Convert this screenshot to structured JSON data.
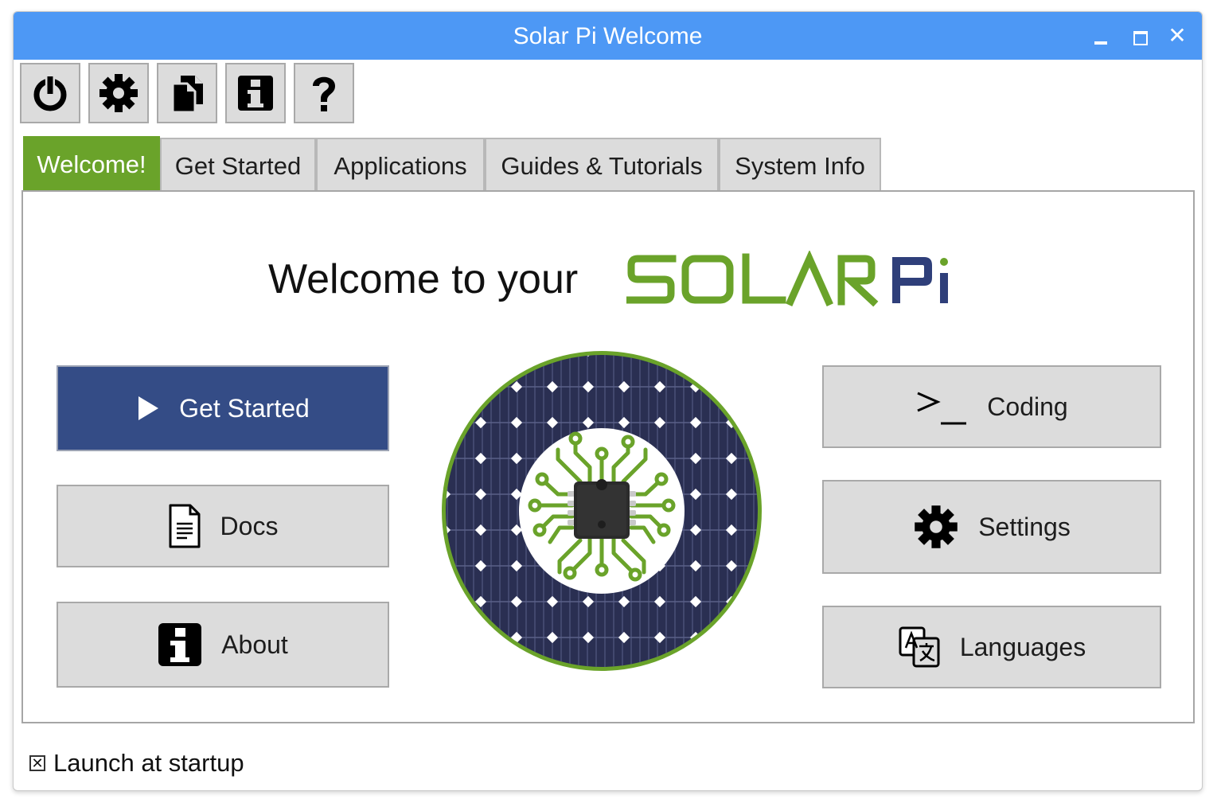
{
  "window": {
    "title": "Solar Pi Welcome",
    "controls": {
      "minimize": "–",
      "maximize": "□",
      "close": "✕"
    }
  },
  "toolbar": {
    "buttons": [
      {
        "name": "power-icon"
      },
      {
        "name": "gear-icon"
      },
      {
        "name": "documents-icon"
      },
      {
        "name": "info-icon"
      },
      {
        "name": "help-icon"
      }
    ]
  },
  "tabs": [
    {
      "label": "Welcome!",
      "active": true
    },
    {
      "label": "Get Started",
      "active": false
    },
    {
      "label": "Applications",
      "active": false
    },
    {
      "label": "Guides & Tutorials",
      "active": false
    },
    {
      "label": "System Info",
      "active": false
    }
  ],
  "welcome": {
    "text": "Welcome to your",
    "logo_word1": "SOLAR",
    "logo_word2": "Pi"
  },
  "left_buttons": [
    {
      "label": "Get Started",
      "icon": "play-icon"
    },
    {
      "label": "Docs",
      "icon": "document-icon"
    },
    {
      "label": "About",
      "icon": "info-icon"
    }
  ],
  "right_buttons": [
    {
      "label": "Coding",
      "icon": "terminal-icon",
      "icon_text": ">_"
    },
    {
      "label": "Settings",
      "icon": "gear-icon"
    },
    {
      "label": "Languages",
      "icon": "translate-icon"
    }
  ],
  "startup": {
    "label": "Launch at startup",
    "checked": true,
    "mark": "✕"
  },
  "colors": {
    "titlebar": "#4d98f5",
    "active_tab": "#6aa32a",
    "primary_button": "#344c86",
    "logo_green": "#6aa32a",
    "logo_navy": "#2f3f7a"
  }
}
